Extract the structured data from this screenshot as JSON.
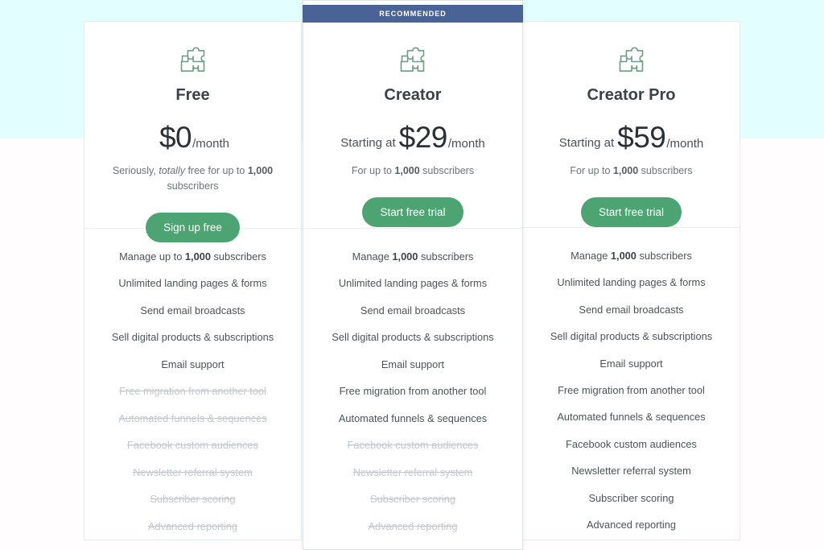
{
  "theme": {
    "band_color": "#e2feff",
    "ribbon_color": "#4a6397",
    "cta_color": "#4ba471",
    "icon_color": "#6d9d85"
  },
  "ribbon": {
    "label": "RECOMMENDED"
  },
  "plans": [
    {
      "id": "free",
      "icon": "puzzle-icon",
      "name": "Free",
      "price_prefix": "",
      "price_amount": "$0",
      "price_period": "/month",
      "note_parts": [
        {
          "text": "Seriously, ",
          "style": "normal"
        },
        {
          "text": "totally",
          "style": "italic"
        },
        {
          "text": " free for up to ",
          "style": "normal"
        },
        {
          "text": "1,000",
          "style": "bold"
        },
        {
          "text": " subscribers",
          "style": "normal"
        }
      ],
      "cta_label": "Sign up free",
      "features": [
        {
          "parts": [
            {
              "text": "Manage up to ",
              "style": "normal"
            },
            {
              "text": "1,000",
              "style": "bold"
            },
            {
              "text": " subscribers",
              "style": "normal"
            }
          ],
          "enabled": true
        },
        {
          "parts": [
            {
              "text": "Unlimited landing pages & forms",
              "style": "normal"
            }
          ],
          "enabled": true
        },
        {
          "parts": [
            {
              "text": "Send email broadcasts",
              "style": "normal"
            }
          ],
          "enabled": true
        },
        {
          "parts": [
            {
              "text": "Sell digital products & subscriptions",
              "style": "normal"
            }
          ],
          "enabled": true
        },
        {
          "parts": [
            {
              "text": "Email support",
              "style": "normal"
            }
          ],
          "enabled": true
        },
        {
          "parts": [
            {
              "text": "Free migration from another tool",
              "style": "normal"
            }
          ],
          "enabled": false
        },
        {
          "parts": [
            {
              "text": "Automated funnels & sequences",
              "style": "normal"
            }
          ],
          "enabled": false
        },
        {
          "parts": [
            {
              "text": "Facebook custom audiences",
              "style": "normal"
            }
          ],
          "enabled": false
        },
        {
          "parts": [
            {
              "text": "Newsletter referral system",
              "style": "normal"
            }
          ],
          "enabled": false
        },
        {
          "parts": [
            {
              "text": "Subscriber scoring",
              "style": "normal"
            }
          ],
          "enabled": false
        },
        {
          "parts": [
            {
              "text": "Advanced reporting",
              "style": "normal"
            }
          ],
          "enabled": false
        }
      ]
    },
    {
      "id": "creator",
      "icon": "puzzle-icon",
      "name": "Creator",
      "price_prefix": "Starting at",
      "price_amount": "$29",
      "price_period": "/month",
      "note_parts": [
        {
          "text": "For up to ",
          "style": "normal"
        },
        {
          "text": "1,000",
          "style": "bold"
        },
        {
          "text": " subscribers",
          "style": "normal"
        }
      ],
      "cta_label": "Start free trial",
      "features": [
        {
          "parts": [
            {
              "text": "Manage ",
              "style": "normal"
            },
            {
              "text": "1,000",
              "style": "bold"
            },
            {
              "text": " subscribers",
              "style": "normal"
            }
          ],
          "enabled": true
        },
        {
          "parts": [
            {
              "text": "Unlimited landing pages & forms",
              "style": "normal"
            }
          ],
          "enabled": true
        },
        {
          "parts": [
            {
              "text": "Send email broadcasts",
              "style": "normal"
            }
          ],
          "enabled": true
        },
        {
          "parts": [
            {
              "text": "Sell digital products & subscriptions",
              "style": "normal"
            }
          ],
          "enabled": true
        },
        {
          "parts": [
            {
              "text": "Email support",
              "style": "normal"
            }
          ],
          "enabled": true
        },
        {
          "parts": [
            {
              "text": "Free migration from another tool",
              "style": "normal"
            }
          ],
          "enabled": true
        },
        {
          "parts": [
            {
              "text": "Automated funnels & sequences",
              "style": "normal"
            }
          ],
          "enabled": true
        },
        {
          "parts": [
            {
              "text": "Facebook custom audiences",
              "style": "normal"
            }
          ],
          "enabled": false
        },
        {
          "parts": [
            {
              "text": "Newsletter referral system",
              "style": "normal"
            }
          ],
          "enabled": false
        },
        {
          "parts": [
            {
              "text": "Subscriber scoring",
              "style": "normal"
            }
          ],
          "enabled": false
        },
        {
          "parts": [
            {
              "text": "Advanced reporting",
              "style": "normal"
            }
          ],
          "enabled": false
        }
      ]
    },
    {
      "id": "creator-pro",
      "icon": "puzzle-icon",
      "name": "Creator Pro",
      "price_prefix": "Starting at",
      "price_amount": "$59",
      "price_period": "/month",
      "note_parts": [
        {
          "text": "For up to ",
          "style": "normal"
        },
        {
          "text": "1,000",
          "style": "bold"
        },
        {
          "text": " subscribers",
          "style": "normal"
        }
      ],
      "cta_label": "Start free trial",
      "features": [
        {
          "parts": [
            {
              "text": "Manage ",
              "style": "normal"
            },
            {
              "text": "1,000",
              "style": "bold"
            },
            {
              "text": " subscribers",
              "style": "normal"
            }
          ],
          "enabled": true
        },
        {
          "parts": [
            {
              "text": "Unlimited landing pages & forms",
              "style": "normal"
            }
          ],
          "enabled": true
        },
        {
          "parts": [
            {
              "text": "Send email broadcasts",
              "style": "normal"
            }
          ],
          "enabled": true
        },
        {
          "parts": [
            {
              "text": "Sell digital products & subscriptions",
              "style": "normal"
            }
          ],
          "enabled": true
        },
        {
          "parts": [
            {
              "text": "Email support",
              "style": "normal"
            }
          ],
          "enabled": true
        },
        {
          "parts": [
            {
              "text": "Free migration from another tool",
              "style": "normal"
            }
          ],
          "enabled": true
        },
        {
          "parts": [
            {
              "text": "Automated funnels & sequences",
              "style": "normal"
            }
          ],
          "enabled": true
        },
        {
          "parts": [
            {
              "text": "Facebook custom audiences",
              "style": "normal"
            }
          ],
          "enabled": true
        },
        {
          "parts": [
            {
              "text": "Newsletter referral system",
              "style": "normal"
            }
          ],
          "enabled": true
        },
        {
          "parts": [
            {
              "text": "Subscriber scoring",
              "style": "normal"
            }
          ],
          "enabled": true
        },
        {
          "parts": [
            {
              "text": "Advanced reporting",
              "style": "normal"
            }
          ],
          "enabled": true
        }
      ]
    }
  ]
}
